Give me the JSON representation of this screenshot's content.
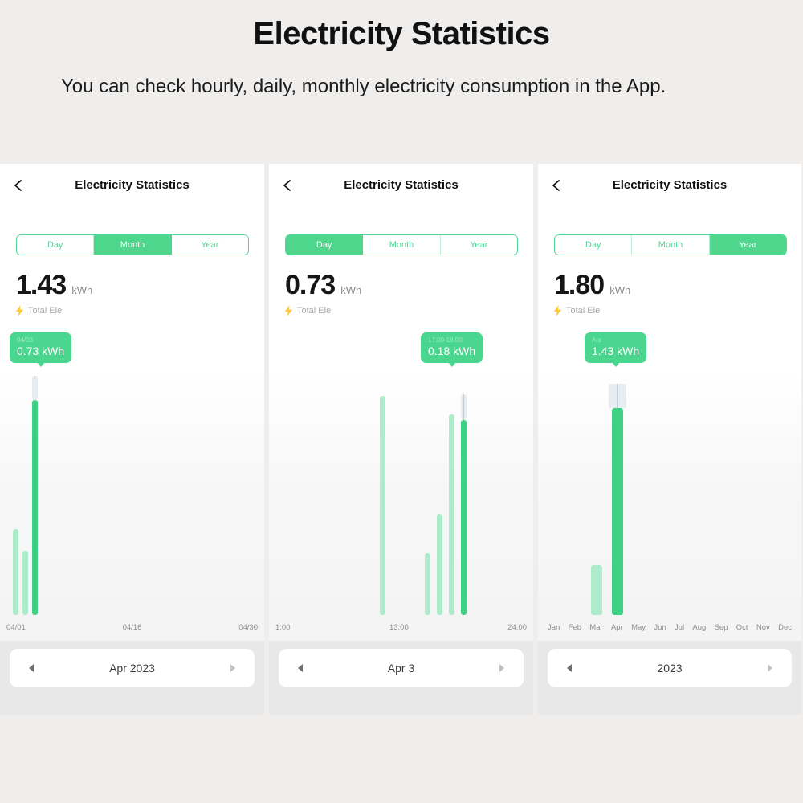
{
  "banner": {
    "title": "Electricity Statistics",
    "subtitle": "You can check hourly, daily, monthly electricity consumption in the App."
  },
  "colors": {
    "accent": "#4ad68f",
    "bar_light": "#aeebca",
    "bar_highlight": "#3fd183",
    "marker": "#e7ecf0",
    "page_bg": "#efeeed",
    "bolt": "#ffc83d"
  },
  "icons": {
    "back": "chevron-left-icon",
    "bolt": "lightning-bolt-icon",
    "prev": "triangle-left-icon",
    "next": "triangle-right-icon"
  },
  "panels": [
    {
      "header_title": "Electricity Statistics",
      "tabs": [
        {
          "label": "Day",
          "active": false
        },
        {
          "label": "Month",
          "active": true
        },
        {
          "label": "Year",
          "active": false
        }
      ],
      "value": "1.43",
      "unit": "kWh",
      "total_label": "Total Ele",
      "tooltip": {
        "caption": "04/03",
        "value": "0.73 kWh"
      },
      "nav": {
        "prev": "◀",
        "label": "Apr 2023",
        "next": "▶"
      },
      "chart_data": {
        "type": "bar",
        "title": "Monthly electricity consumption",
        "xlabel": "",
        "ylabel": "kWh",
        "ylim": [
          0,
          0.8
        ],
        "grid": false,
        "legend": false,
        "axis_ticks": [
          "04/01",
          "04/16",
          "04/30"
        ],
        "selected": "04/03",
        "categories": [
          "04/01",
          "04/02",
          "04/03"
        ],
        "values": [
          0.23,
          0.17,
          0.73
        ],
        "annotation": "04/03  0.73 kWh"
      }
    },
    {
      "header_title": "Electricity Statistics",
      "tabs": [
        {
          "label": "Day",
          "active": true
        },
        {
          "label": "Month",
          "active": false
        },
        {
          "label": "Year",
          "active": false
        }
      ],
      "value": "0.73",
      "unit": "kWh",
      "total_label": "Total Ele",
      "tooltip": {
        "caption": "17:00-18:00",
        "value": "0.18 kWh"
      },
      "nav": {
        "prev": "◀",
        "label": "Apr 3",
        "next": "▶"
      },
      "chart_data": {
        "type": "bar",
        "title": "Hourly electricity consumption",
        "xlabel": "",
        "ylabel": "kWh",
        "ylim": [
          0,
          0.22
        ],
        "grid": false,
        "legend": false,
        "axis_ticks": [
          "1:00",
          "13:00",
          "24:00"
        ],
        "selected": "17:00-18:00",
        "categories": [
          "12:00",
          "15:00",
          "16:00",
          "17:00",
          "17:00-18:00"
        ],
        "values": [
          0.205,
          0.058,
          0.095,
          0.185,
          0.18
        ],
        "annotation": "17:00-18:00  0.18 kWh"
      }
    },
    {
      "header_title": "Electricity Statistics",
      "tabs": [
        {
          "label": "Day",
          "active": false
        },
        {
          "label": "Month",
          "active": false
        },
        {
          "label": "Year",
          "active": true
        }
      ],
      "value": "1.80",
      "unit": "kWh",
      "total_label": "Total Ele",
      "tooltip": {
        "caption": "Apr",
        "value": "1.43 kWh"
      },
      "nav": {
        "prev": "◀",
        "label": "2023",
        "next": "▶"
      },
      "chart_data": {
        "type": "bar",
        "title": "Yearly electricity consumption by month",
        "xlabel": "",
        "ylabel": "kWh",
        "ylim": [
          0,
          1.6
        ],
        "grid": false,
        "legend": false,
        "axis_ticks": [
          "Jan",
          "Feb",
          "Mar",
          "Apr",
          "May",
          "Jun",
          "Jul",
          "Aug",
          "Sep",
          "Oct",
          "Nov",
          "Dec"
        ],
        "selected": "Apr",
        "categories": [
          "Jan",
          "Feb",
          "Mar",
          "Apr",
          "May",
          "Jun",
          "Jul",
          "Aug",
          "Sep",
          "Oct",
          "Nov",
          "Dec"
        ],
        "values": [
          0,
          0,
          0.22,
          1.43,
          0,
          0,
          0,
          0,
          0,
          0,
          0,
          0
        ],
        "annotation": "Apr  1.43 kWh"
      }
    }
  ]
}
